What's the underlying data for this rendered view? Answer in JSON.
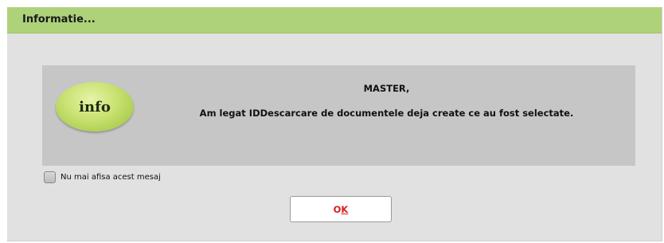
{
  "window": {
    "title": "Informatie..."
  },
  "message": {
    "badge_text": "info",
    "title": "MASTER,",
    "body": "Am legat IDDescarcare de documentele deja create ce au fost selectate."
  },
  "checkbox": {
    "label": "Nu mai afisa acest mesaj",
    "checked": false
  },
  "buttons": {
    "ok_first": "O",
    "ok_underlined": "K"
  },
  "colors": {
    "titlebar": "#aed27a",
    "panel": "#c6c6c6",
    "dialog_bg": "#e1e1e1",
    "ok_text": "#d62020"
  },
  "icons": {
    "info": "info-badge-icon"
  }
}
